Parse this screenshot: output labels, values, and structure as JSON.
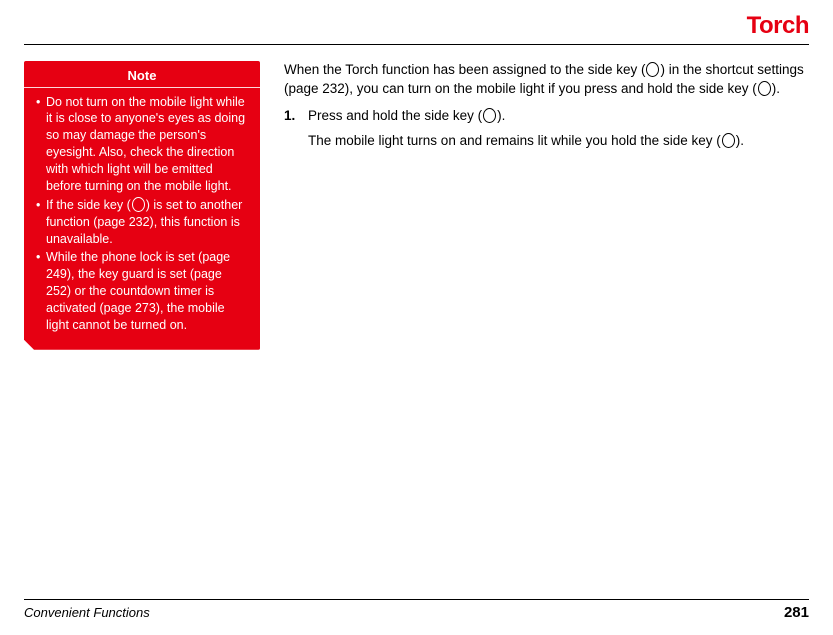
{
  "title": "Torch",
  "note": {
    "header": "Note",
    "items": [
      "Do not turn on the mobile light while it is close to anyone's eyes as doing so may damage the person's eyesight. Also, check the direction with which light will be emitted before turning on the mobile light.",
      {
        "pre": "If the side key (",
        "post": ") is set to another function (page 232), this function is unavailable."
      },
      "While the phone lock is set (page 249), the key guard is set (page 252) or the countdown timer is activated (page 273), the mobile light cannot be turned on."
    ]
  },
  "main": {
    "intro": {
      "pre": "When the Torch function has been assigned to the side key (",
      "mid1": ") in the shortcut settings (page 232), you can turn on the mobile light if you press and hold the side key (",
      "post": ")."
    },
    "step_num": "1.",
    "step_text": {
      "pre": "Press and hold the side key (",
      "post": ")."
    },
    "step_sub": {
      "pre": "The mobile light turns on and remains lit while you hold the side key (",
      "post": ")."
    }
  },
  "footer": {
    "section": "Convenient Functions",
    "page": "281"
  }
}
